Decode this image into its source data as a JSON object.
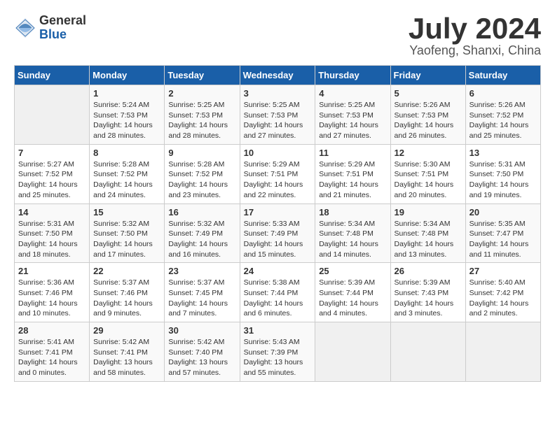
{
  "header": {
    "logo_general": "General",
    "logo_blue": "Blue",
    "month_title": "July 2024",
    "location": "Yaofeng, Shanxi, China"
  },
  "calendar": {
    "days_of_week": [
      "Sunday",
      "Monday",
      "Tuesday",
      "Wednesday",
      "Thursday",
      "Friday",
      "Saturday"
    ],
    "weeks": [
      [
        {
          "day": "",
          "info": ""
        },
        {
          "day": "1",
          "info": "Sunrise: 5:24 AM\nSunset: 7:53 PM\nDaylight: 14 hours\nand 28 minutes."
        },
        {
          "day": "2",
          "info": "Sunrise: 5:25 AM\nSunset: 7:53 PM\nDaylight: 14 hours\nand 28 minutes."
        },
        {
          "day": "3",
          "info": "Sunrise: 5:25 AM\nSunset: 7:53 PM\nDaylight: 14 hours\nand 27 minutes."
        },
        {
          "day": "4",
          "info": "Sunrise: 5:25 AM\nSunset: 7:53 PM\nDaylight: 14 hours\nand 27 minutes."
        },
        {
          "day": "5",
          "info": "Sunrise: 5:26 AM\nSunset: 7:53 PM\nDaylight: 14 hours\nand 26 minutes."
        },
        {
          "day": "6",
          "info": "Sunrise: 5:26 AM\nSunset: 7:52 PM\nDaylight: 14 hours\nand 25 minutes."
        }
      ],
      [
        {
          "day": "7",
          "info": "Sunrise: 5:27 AM\nSunset: 7:52 PM\nDaylight: 14 hours\nand 25 minutes."
        },
        {
          "day": "8",
          "info": "Sunrise: 5:28 AM\nSunset: 7:52 PM\nDaylight: 14 hours\nand 24 minutes."
        },
        {
          "day": "9",
          "info": "Sunrise: 5:28 AM\nSunset: 7:52 PM\nDaylight: 14 hours\nand 23 minutes."
        },
        {
          "day": "10",
          "info": "Sunrise: 5:29 AM\nSunset: 7:51 PM\nDaylight: 14 hours\nand 22 minutes."
        },
        {
          "day": "11",
          "info": "Sunrise: 5:29 AM\nSunset: 7:51 PM\nDaylight: 14 hours\nand 21 minutes."
        },
        {
          "day": "12",
          "info": "Sunrise: 5:30 AM\nSunset: 7:51 PM\nDaylight: 14 hours\nand 20 minutes."
        },
        {
          "day": "13",
          "info": "Sunrise: 5:31 AM\nSunset: 7:50 PM\nDaylight: 14 hours\nand 19 minutes."
        }
      ],
      [
        {
          "day": "14",
          "info": "Sunrise: 5:31 AM\nSunset: 7:50 PM\nDaylight: 14 hours\nand 18 minutes."
        },
        {
          "day": "15",
          "info": "Sunrise: 5:32 AM\nSunset: 7:50 PM\nDaylight: 14 hours\nand 17 minutes."
        },
        {
          "day": "16",
          "info": "Sunrise: 5:32 AM\nSunset: 7:49 PM\nDaylight: 14 hours\nand 16 minutes."
        },
        {
          "day": "17",
          "info": "Sunrise: 5:33 AM\nSunset: 7:49 PM\nDaylight: 14 hours\nand 15 minutes."
        },
        {
          "day": "18",
          "info": "Sunrise: 5:34 AM\nSunset: 7:48 PM\nDaylight: 14 hours\nand 14 minutes."
        },
        {
          "day": "19",
          "info": "Sunrise: 5:34 AM\nSunset: 7:48 PM\nDaylight: 14 hours\nand 13 minutes."
        },
        {
          "day": "20",
          "info": "Sunrise: 5:35 AM\nSunset: 7:47 PM\nDaylight: 14 hours\nand 11 minutes."
        }
      ],
      [
        {
          "day": "21",
          "info": "Sunrise: 5:36 AM\nSunset: 7:46 PM\nDaylight: 14 hours\nand 10 minutes."
        },
        {
          "day": "22",
          "info": "Sunrise: 5:37 AM\nSunset: 7:46 PM\nDaylight: 14 hours\nand 9 minutes."
        },
        {
          "day": "23",
          "info": "Sunrise: 5:37 AM\nSunset: 7:45 PM\nDaylight: 14 hours\nand 7 minutes."
        },
        {
          "day": "24",
          "info": "Sunrise: 5:38 AM\nSunset: 7:44 PM\nDaylight: 14 hours\nand 6 minutes."
        },
        {
          "day": "25",
          "info": "Sunrise: 5:39 AM\nSunset: 7:44 PM\nDaylight: 14 hours\nand 4 minutes."
        },
        {
          "day": "26",
          "info": "Sunrise: 5:39 AM\nSunset: 7:43 PM\nDaylight: 14 hours\nand 3 minutes."
        },
        {
          "day": "27",
          "info": "Sunrise: 5:40 AM\nSunset: 7:42 PM\nDaylight: 14 hours\nand 2 minutes."
        }
      ],
      [
        {
          "day": "28",
          "info": "Sunrise: 5:41 AM\nSunset: 7:41 PM\nDaylight: 14 hours\nand 0 minutes."
        },
        {
          "day": "29",
          "info": "Sunrise: 5:42 AM\nSunset: 7:41 PM\nDaylight: 13 hours\nand 58 minutes."
        },
        {
          "day": "30",
          "info": "Sunrise: 5:42 AM\nSunset: 7:40 PM\nDaylight: 13 hours\nand 57 minutes."
        },
        {
          "day": "31",
          "info": "Sunrise: 5:43 AM\nSunset: 7:39 PM\nDaylight: 13 hours\nand 55 minutes."
        },
        {
          "day": "",
          "info": ""
        },
        {
          "day": "",
          "info": ""
        },
        {
          "day": "",
          "info": ""
        }
      ]
    ]
  }
}
